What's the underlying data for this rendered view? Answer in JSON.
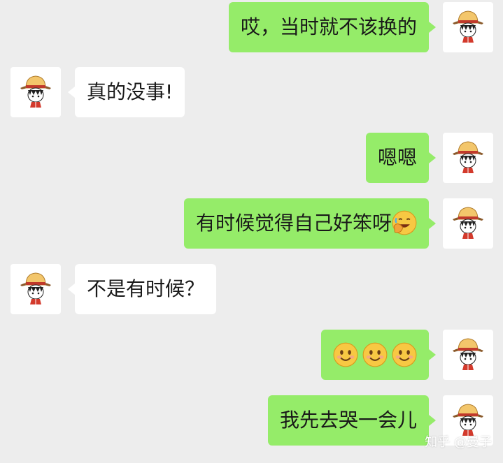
{
  "messages": [
    {
      "side": "out",
      "text": "哎，当时就不该换的"
    },
    {
      "side": "in",
      "text": "真的没事!"
    },
    {
      "side": "out",
      "text": "嗯嗯"
    },
    {
      "side": "out",
      "text": "有时候觉得自己好笨呀"
    },
    {
      "side": "in",
      "text": "不是有时候？"
    },
    {
      "side": "out",
      "text": ""
    },
    {
      "side": "out",
      "text": "我先去哭一会儿"
    }
  ],
  "emojis": {
    "facepalm_laugh": "laughing-facepalm-emoji",
    "smile": "smiling-face-emoji"
  },
  "colors": {
    "background": "#ededed",
    "outgoing_bubble": "#95ec69",
    "incoming_bubble": "#ffffff",
    "text": "#191919"
  },
  "watermark": "知乎 @曼子"
}
